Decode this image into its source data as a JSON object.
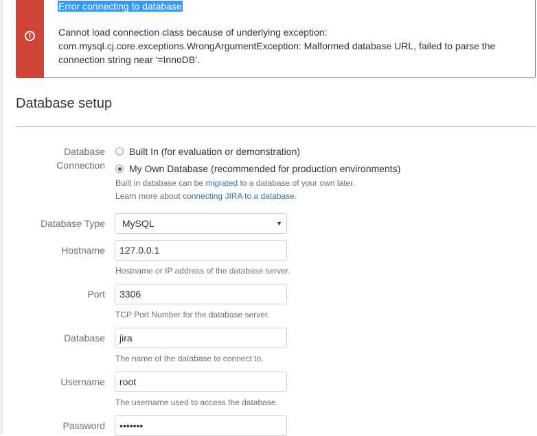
{
  "error": {
    "icon": "exclamation-circle-icon",
    "title": "Error connecting to database",
    "message": "Cannot load connection class because of underlying exception: com.mysql.cj.core.exceptions.WrongArgumentException: Malformed database URL, failed to parse the connection string near '=InnoDB'.",
    "color": "#d04437"
  },
  "section": {
    "title": "Database setup"
  },
  "form": {
    "connection": {
      "label_line1": "Database",
      "label_line2": "Connection",
      "options": [
        {
          "label": "Built In (for evaluation or demonstration)",
          "checked": false
        },
        {
          "label": "My Own Database (recommended for production environments)",
          "checked": true
        }
      ],
      "help1_prefix": "Built in database can be ",
      "help1_link": "migrated",
      "help1_suffix": " to a database of your own later.",
      "help2_prefix": "Learn more about ",
      "help2_link": "connecting JIRA to a database",
      "help2_suffix": "."
    },
    "database_type": {
      "label": "Database Type",
      "value": "MySQL",
      "arrow": "▼"
    },
    "hostname": {
      "label": "Hostname",
      "value": "127.0.0.1",
      "help": "Hostname or IP address of the database server."
    },
    "port": {
      "label": "Port",
      "value": "3306",
      "help": "TCP Port Number for the database server."
    },
    "database": {
      "label": "Database",
      "value": "jira",
      "help": "The name of the database to connect to."
    },
    "username": {
      "label": "Username",
      "value": "root",
      "help": "The username used to access the database."
    },
    "password": {
      "label": "Password",
      "value": "•••••••"
    }
  },
  "colors": {
    "link": "#3572b0",
    "label": "#707070",
    "selection": "#3399ff"
  }
}
